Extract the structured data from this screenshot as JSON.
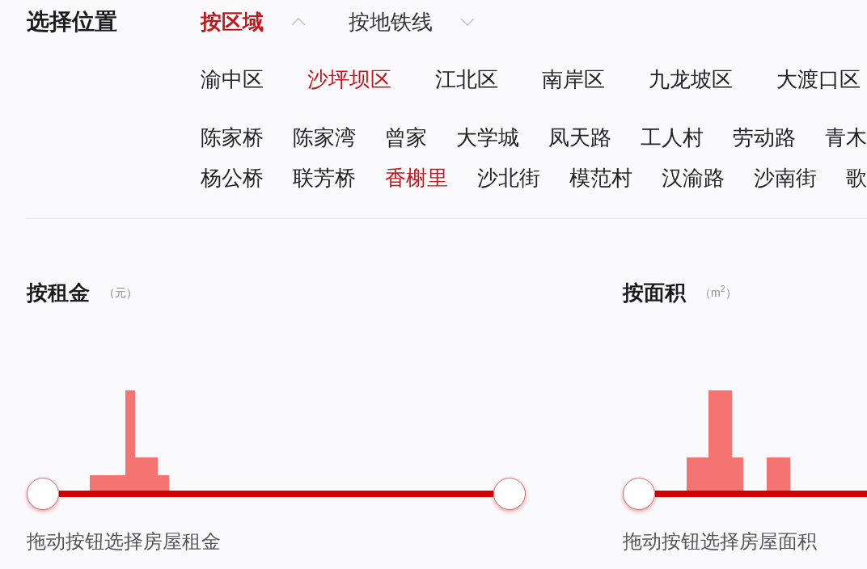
{
  "title": "选择位置",
  "location_tabs": [
    {
      "label": "按区域",
      "selected": true,
      "expanded": true
    },
    {
      "label": "按地铁线",
      "selected": false,
      "expanded": false
    }
  ],
  "districts": [
    {
      "label": "渝中区",
      "selected": false
    },
    {
      "label": "沙坪坝区",
      "selected": true
    },
    {
      "label": "江北区",
      "selected": false
    },
    {
      "label": "南岸区",
      "selected": false
    },
    {
      "label": "九龙坡区",
      "selected": false
    },
    {
      "label": "大渡口区",
      "selected": false
    }
  ],
  "neighborhood_rows": [
    {
      "items": [
        {
          "label": "陈家桥",
          "selected": false
        },
        {
          "label": "陈家湾",
          "selected": false
        },
        {
          "label": "曾家",
          "selected": false
        },
        {
          "label": "大学城",
          "selected": false
        },
        {
          "label": "凤天路",
          "selected": false
        },
        {
          "label": "工人村",
          "selected": false
        },
        {
          "label": "劳动路",
          "selected": false
        },
        {
          "label": "青木",
          "selected": false
        }
      ]
    },
    {
      "items": [
        {
          "label": "杨公桥",
          "selected": false
        },
        {
          "label": "联芳桥",
          "selected": false
        },
        {
          "label": "香榭里",
          "selected": true
        },
        {
          "label": "沙北街",
          "selected": false
        },
        {
          "label": "模范村",
          "selected": false
        },
        {
          "label": "汉渝路",
          "selected": false
        },
        {
          "label": "沙南街",
          "selected": false
        },
        {
          "label": "歌",
          "selected": false
        }
      ]
    }
  ],
  "filters": [
    {
      "title": "按租金",
      "unit": "（元）",
      "hint": "拖动按钮选择房屋租金",
      "thumbs": [
        {
          "level": 0
        },
        {
          "level": 1
        }
      ]
    },
    {
      "title": "按面积",
      "unit": "（m$^{2}$）",
      "hint": "拖动按钮选择房屋面积",
      "thumbs": [
        {
          "level": 0
        }
      ]
    }
  ]
}
